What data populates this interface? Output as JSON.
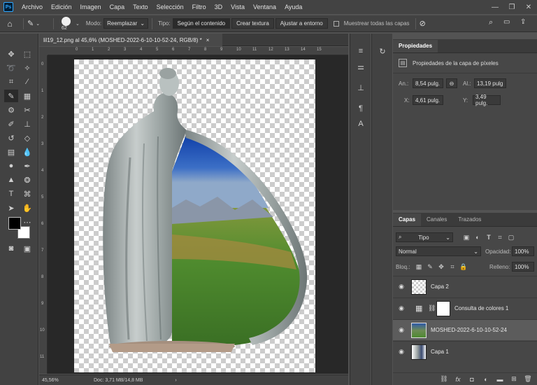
{
  "menubar": {
    "logo": "Ps",
    "items": [
      "Archivo",
      "Edición",
      "Imagen",
      "Capa",
      "Texto",
      "Selección",
      "Filtro",
      "3D",
      "Vista",
      "Ventana",
      "Ayuda"
    ]
  },
  "options": {
    "brush_size": "62",
    "mode_label": "Modo:",
    "mode_value": "Reemplazar",
    "type_label": "Tipo:",
    "type_buttons": [
      "Según el contenido",
      "Crear textura",
      "Ajustar a entorno"
    ],
    "sample_all_label": "Muestrear todas las capas"
  },
  "document": {
    "tab_title": "lil19_12.png al 45,6% (MOSHED-2022-6-10-10-52-24, RGB/8) *",
    "tab_close": "×",
    "ruler_h": [
      "0",
      "1",
      "2",
      "3",
      "4",
      "5",
      "6",
      "7",
      "8",
      "9",
      "10",
      "11",
      "12",
      "13",
      "14",
      "15"
    ],
    "ruler_v": [
      "0",
      "1",
      "2",
      "3",
      "4",
      "5",
      "6",
      "7",
      "8",
      "9",
      "10",
      "11"
    ]
  },
  "status": {
    "zoom": "45,56%",
    "doc_info": "Doc: 3,71 MB/14,8 MB",
    "arrow": "›"
  },
  "properties": {
    "tab": "Propiedades",
    "subtitle": "Propiedades de la capa de píxeles",
    "w_label": "An.:",
    "w_value": "8,54 pulg.",
    "h_label": "Al.:",
    "h_value": "13,19 pulg",
    "x_label": "X:",
    "x_value": "4,61 pulg.",
    "y_label": "Y:",
    "y_value": "3,49 pulg."
  },
  "layers_panel": {
    "tabs": [
      "Capas",
      "Canales",
      "Trazados"
    ],
    "filter_value": "Tipo",
    "blend_mode": "Normal",
    "opacity_label": "Opacidad:",
    "opacity_value": "100%",
    "lock_label": "Bloq.:",
    "fill_label": "Relleno:",
    "fill_value": "100%",
    "layers": [
      {
        "name": "Capa 2"
      },
      {
        "name": "Consulta de colores 1"
      },
      {
        "name": "MOSHED-2022-6-10-10-52-24"
      },
      {
        "name": "Capa 1"
      }
    ],
    "footer_fx": "fx"
  }
}
